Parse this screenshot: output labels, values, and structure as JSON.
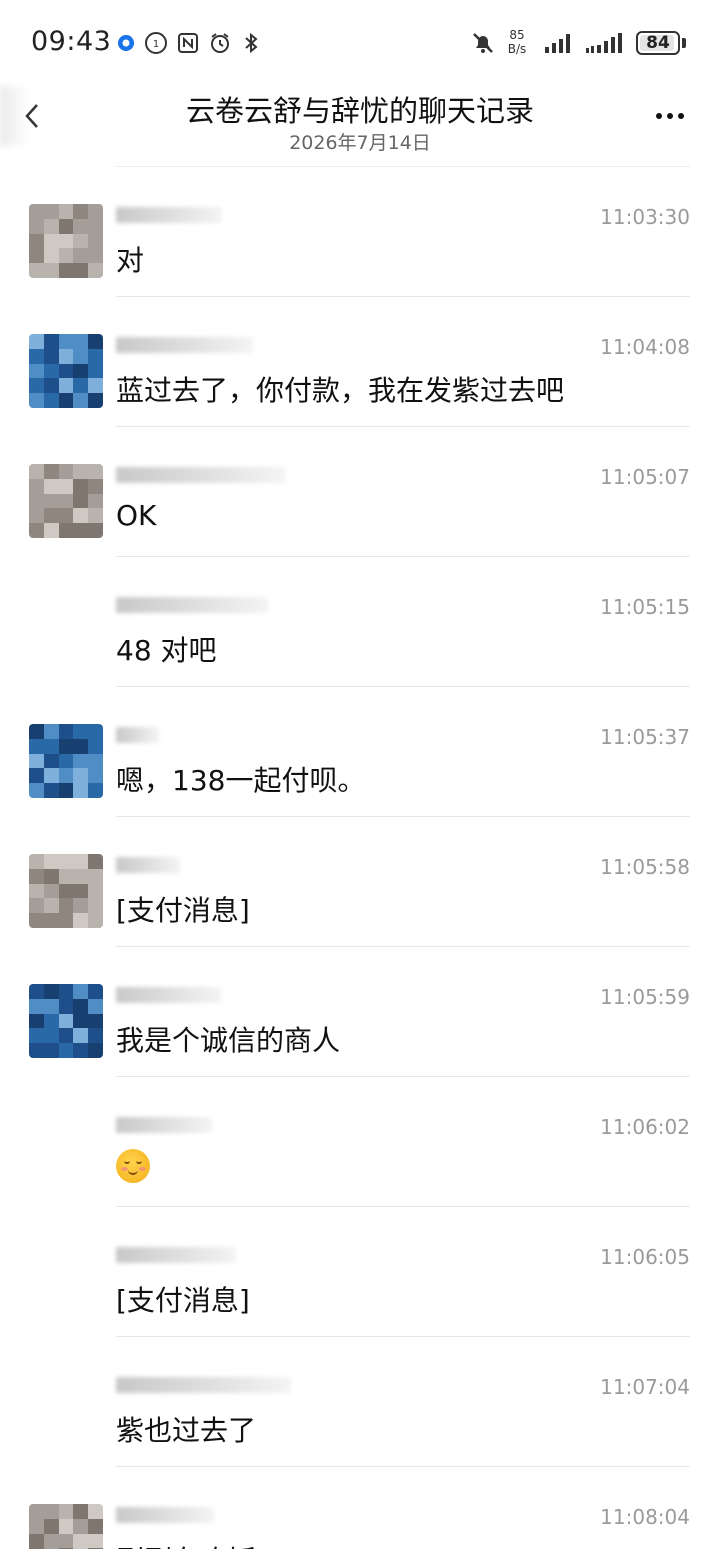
{
  "status_bar": {
    "time": "09:43",
    "net_speed_value": "85",
    "net_speed_unit": "B/s",
    "battery": "84",
    "left_icons": [
      "location-dot-icon",
      "nfc-sim-icon",
      "nfc-icon",
      "alarm-icon",
      "bluetooth-icon"
    ],
    "right_icons": [
      "mute-bell-icon",
      "signal-icon",
      "signal-icon-2"
    ]
  },
  "header": {
    "title": "云卷云舒与辞忧的聊天记录",
    "subtitle": "2026年7月14日"
  },
  "colors": {
    "avatar_a": [
      "#b9b3ae",
      "#8f8680",
      "#a59d97",
      "#cfc9c4",
      "#7f7670"
    ],
    "avatar_b": [
      "#1f4f8a",
      "#2a69a8",
      "#4f8dc4",
      "#173f70",
      "#7fb0db"
    ]
  },
  "messages": [
    {
      "time": "11:03:30",
      "text": "对",
      "avatar": "a"
    },
    {
      "time": "11:04:08",
      "text": "蓝过去了，你付款，我在发紫过去吧",
      "avatar": "b"
    },
    {
      "time": "11:05:07",
      "text": "OK",
      "avatar": "a"
    },
    {
      "time": "11:05:15",
      "text": "48 对吧",
      "avatar": "none"
    },
    {
      "time": "11:05:37",
      "text": "嗯，138一起付呗。",
      "avatar": "b"
    },
    {
      "time": "11:05:58",
      "text": "[支付消息]",
      "avatar": "a"
    },
    {
      "time": "11:05:59",
      "text": "我是个诚信的商人",
      "avatar": "b"
    },
    {
      "time": "11:06:02",
      "text": "",
      "avatar": "none",
      "emoji": "blush-smile-emoji"
    },
    {
      "time": "11:06:05",
      "text": "[支付消息]",
      "avatar": "none"
    },
    {
      "time": "11:07:04",
      "text": "紫也过去了",
      "avatar": "none"
    },
    {
      "time": "11:08:04",
      "text": "刚刚在吃饭",
      "avatar": "a"
    }
  ]
}
